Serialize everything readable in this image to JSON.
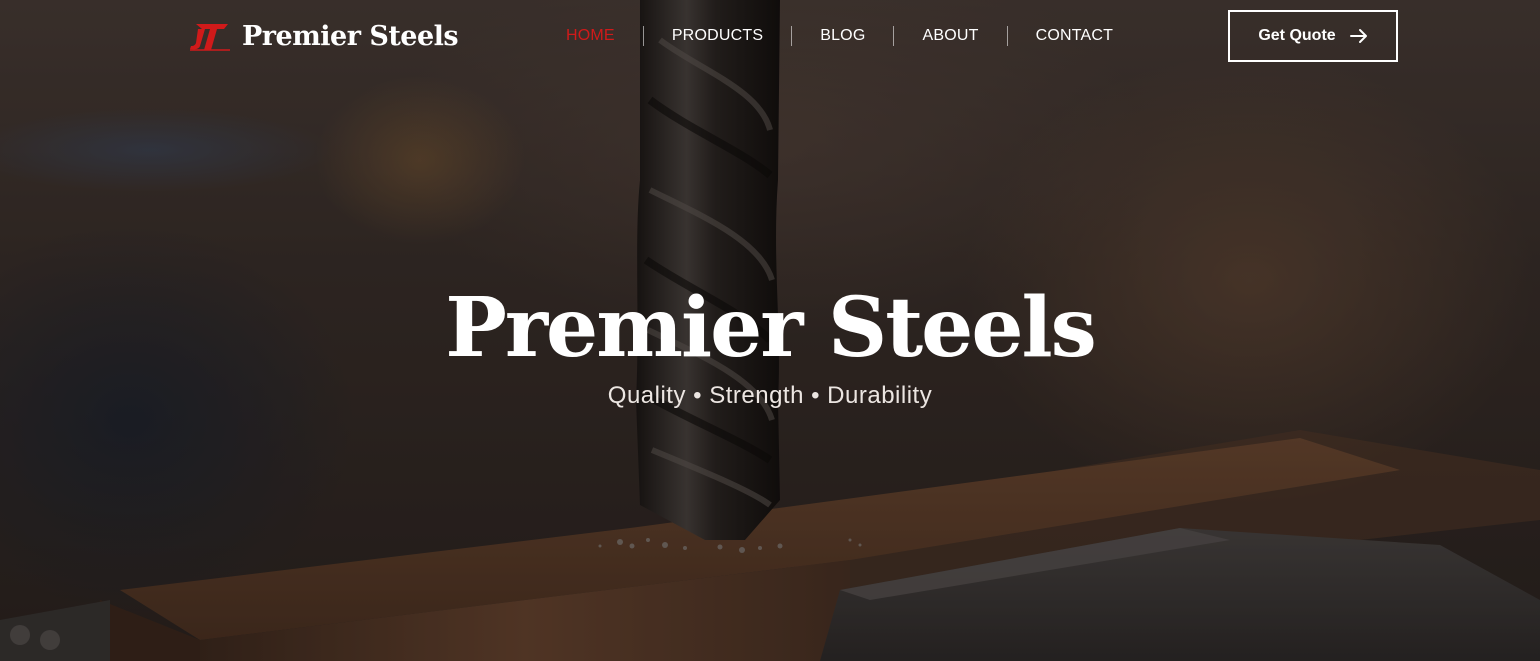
{
  "brand": {
    "name": "Premier Steels",
    "logo_mark": "PT",
    "logo_color": "#d01a1a"
  },
  "nav": {
    "items": [
      {
        "label": "HOME",
        "active": true
      },
      {
        "label": "PRODUCTS",
        "active": false
      },
      {
        "label": "BLOG",
        "active": false
      },
      {
        "label": "ABOUT",
        "active": false
      },
      {
        "label": "CONTACT",
        "active": false
      }
    ],
    "active_color": "#d01a1a"
  },
  "cta": {
    "label": "Get Quote",
    "icon": "arrow-right-icon"
  },
  "hero": {
    "title": "Premier Steels",
    "tagline": "Quality • Strength • Durability",
    "background": "drill bit boring into a steel workpiece clamped in a vise"
  }
}
